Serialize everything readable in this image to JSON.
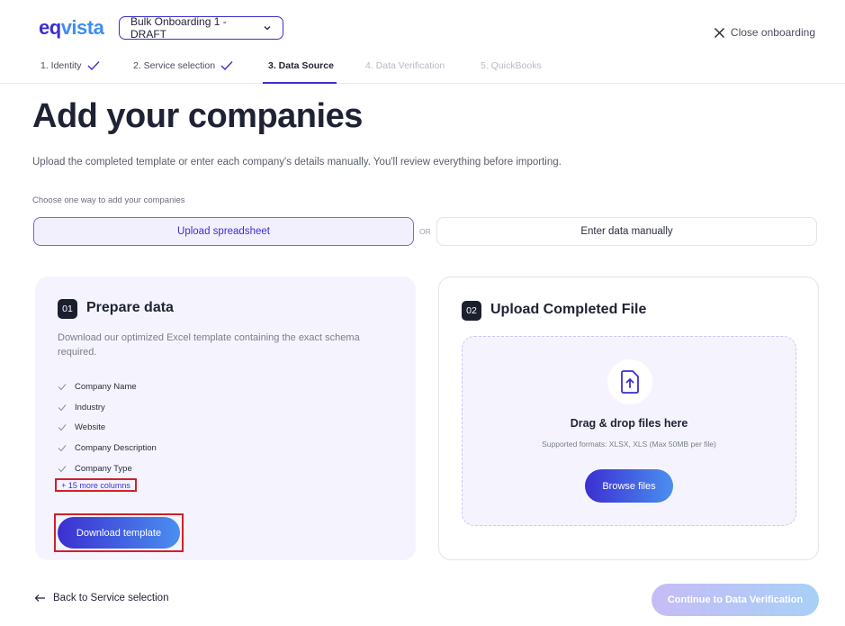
{
  "header": {
    "logo_part1": "eq",
    "logo_part2": "vista",
    "draft_select": "Bulk Onboarding 1 - DRAFT",
    "close_label": "Close onboarding"
  },
  "stepper": {
    "steps": [
      {
        "label": "1. Identity",
        "state": "done"
      },
      {
        "label": "2. Service selection",
        "state": "done"
      },
      {
        "label": "3. Data Source",
        "state": "active"
      },
      {
        "label": "4. Data Verification",
        "state": "future"
      },
      {
        "label": "5. QuickBooks",
        "state": "future"
      }
    ]
  },
  "main": {
    "title": "Add your companies",
    "subtitle": "Upload the completed template or enter each company's details manually. You'll review everything before importing.",
    "choose_label": "Choose one way to add your companies",
    "option_upload": "Upload spreadsheet",
    "or_label": "OR",
    "option_manual": "Enter data manually"
  },
  "prepare": {
    "badge": "01",
    "title": "Prepare data",
    "description": "Download our optimized Excel template containing the exact schema required.",
    "columns": [
      "Company Name",
      "Industry",
      "Website",
      "Company Description",
      "Company Type"
    ],
    "more_columns": "+ 15 more columns",
    "download_button": "Download template"
  },
  "upload": {
    "badge": "02",
    "title": "Upload Completed File",
    "drop_title": "Drag & drop files here",
    "formats": "Supported formats: XLSX, XLS (Max 50MB per file)",
    "browse_button": "Browse files"
  },
  "footer": {
    "back_label": "Back to Service selection",
    "continue_label": "Continue to Data Verification"
  },
  "colors": {
    "primary": "#3b2fd1",
    "accent": "#4a8ff0",
    "highlight_box": "#d0202a"
  }
}
